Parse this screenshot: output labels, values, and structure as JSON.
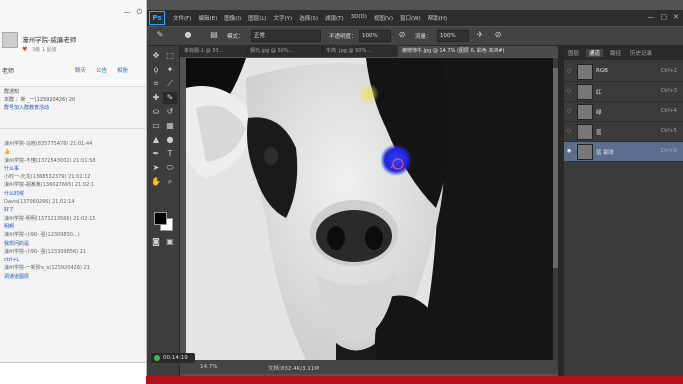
{
  "chat": {
    "group_name": "濠州学院-威廉老师",
    "level_text": "3级 1 星级",
    "teacher_label": "老师",
    "tabs": [
      "聊天",
      "公告",
      "相册"
    ],
    "notice_lines": [
      "群通知",
      "本群 ：新  _一(125920426) 20",
      "群号加入群教育活动"
    ],
    "messages": [
      {
        "meta": "濠州学院-马晓(835775476) 21:01:44",
        "body": ""
      },
      {
        "meta": "濠州学院-不懂(1372543002) 21:01:58",
        "body": "什么事"
      },
      {
        "meta": "小时一-元龙(1368532379) 21:02:12",
        "body": ""
      },
      {
        "meta": "濠州学院-胡某某(136027665) 21:02:1",
        "body": "什么时候"
      },
      {
        "meta": "Davis(137060266) 21:02:14",
        "body": "好了"
      },
      {
        "meta": "濠州学院-明明(1373213566) 21:02:15",
        "body": "明啊"
      },
      {
        "meta": "濠州学院-小90- 强(12309850...)",
        "body": "我想问的是"
      },
      {
        "meta": "濠州学院-小90- 强(123309856) 21",
        "body": "ctrl+L"
      },
      {
        "meta": "濠州学院-一新阶o_o(125920426) 21",
        "body": "调通道图层"
      }
    ]
  },
  "ps": {
    "logo": "Ps",
    "menus": [
      "文件(F)",
      "编辑(E)",
      "图像(I)",
      "图层(L)",
      "文字(Y)",
      "选择(S)",
      "滤镜(T)",
      "3D(D)",
      "视图(V)",
      "窗口(W)",
      "帮助(H)"
    ],
    "options": {
      "mode_label": "模式：",
      "mode_value": "正常",
      "opacity_label": "不透明度：",
      "opacity_value": "100%",
      "flow_label": "流量：",
      "flow_value": "100%"
    },
    "doc_tabs": [
      {
        "label": "未标题-1 @ 33...",
        "active": false
      },
      {
        "label": "钢元.jpg @ 50%...",
        "active": false
      },
      {
        "label": "牛肉 .jpg @ 50%...",
        "active": false
      },
      {
        "label": "被修饰牛.jpg @ 14.7% (图层 0, 彩色 本/8#)",
        "active": true
      }
    ],
    "status": {
      "zoom": "14.7%",
      "doc": "文档:832.4K/3.11M"
    },
    "timer": "00:14:19",
    "panel_tabs": [
      "图层",
      "通道",
      "路径",
      "历史记录"
    ],
    "active_panel_tab": "通道",
    "channels": [
      {
        "name": "RGB",
        "shortcut": "Ctrl+2",
        "selected": false
      },
      {
        "name": "红",
        "shortcut": "Ctrl+3",
        "selected": false
      },
      {
        "name": "绿",
        "shortcut": "Ctrl+4",
        "selected": false
      },
      {
        "name": "蓝",
        "shortcut": "Ctrl+5",
        "selected": false
      },
      {
        "name": "蓝 副本",
        "shortcut": "Ctrl+6",
        "selected": true
      }
    ]
  }
}
